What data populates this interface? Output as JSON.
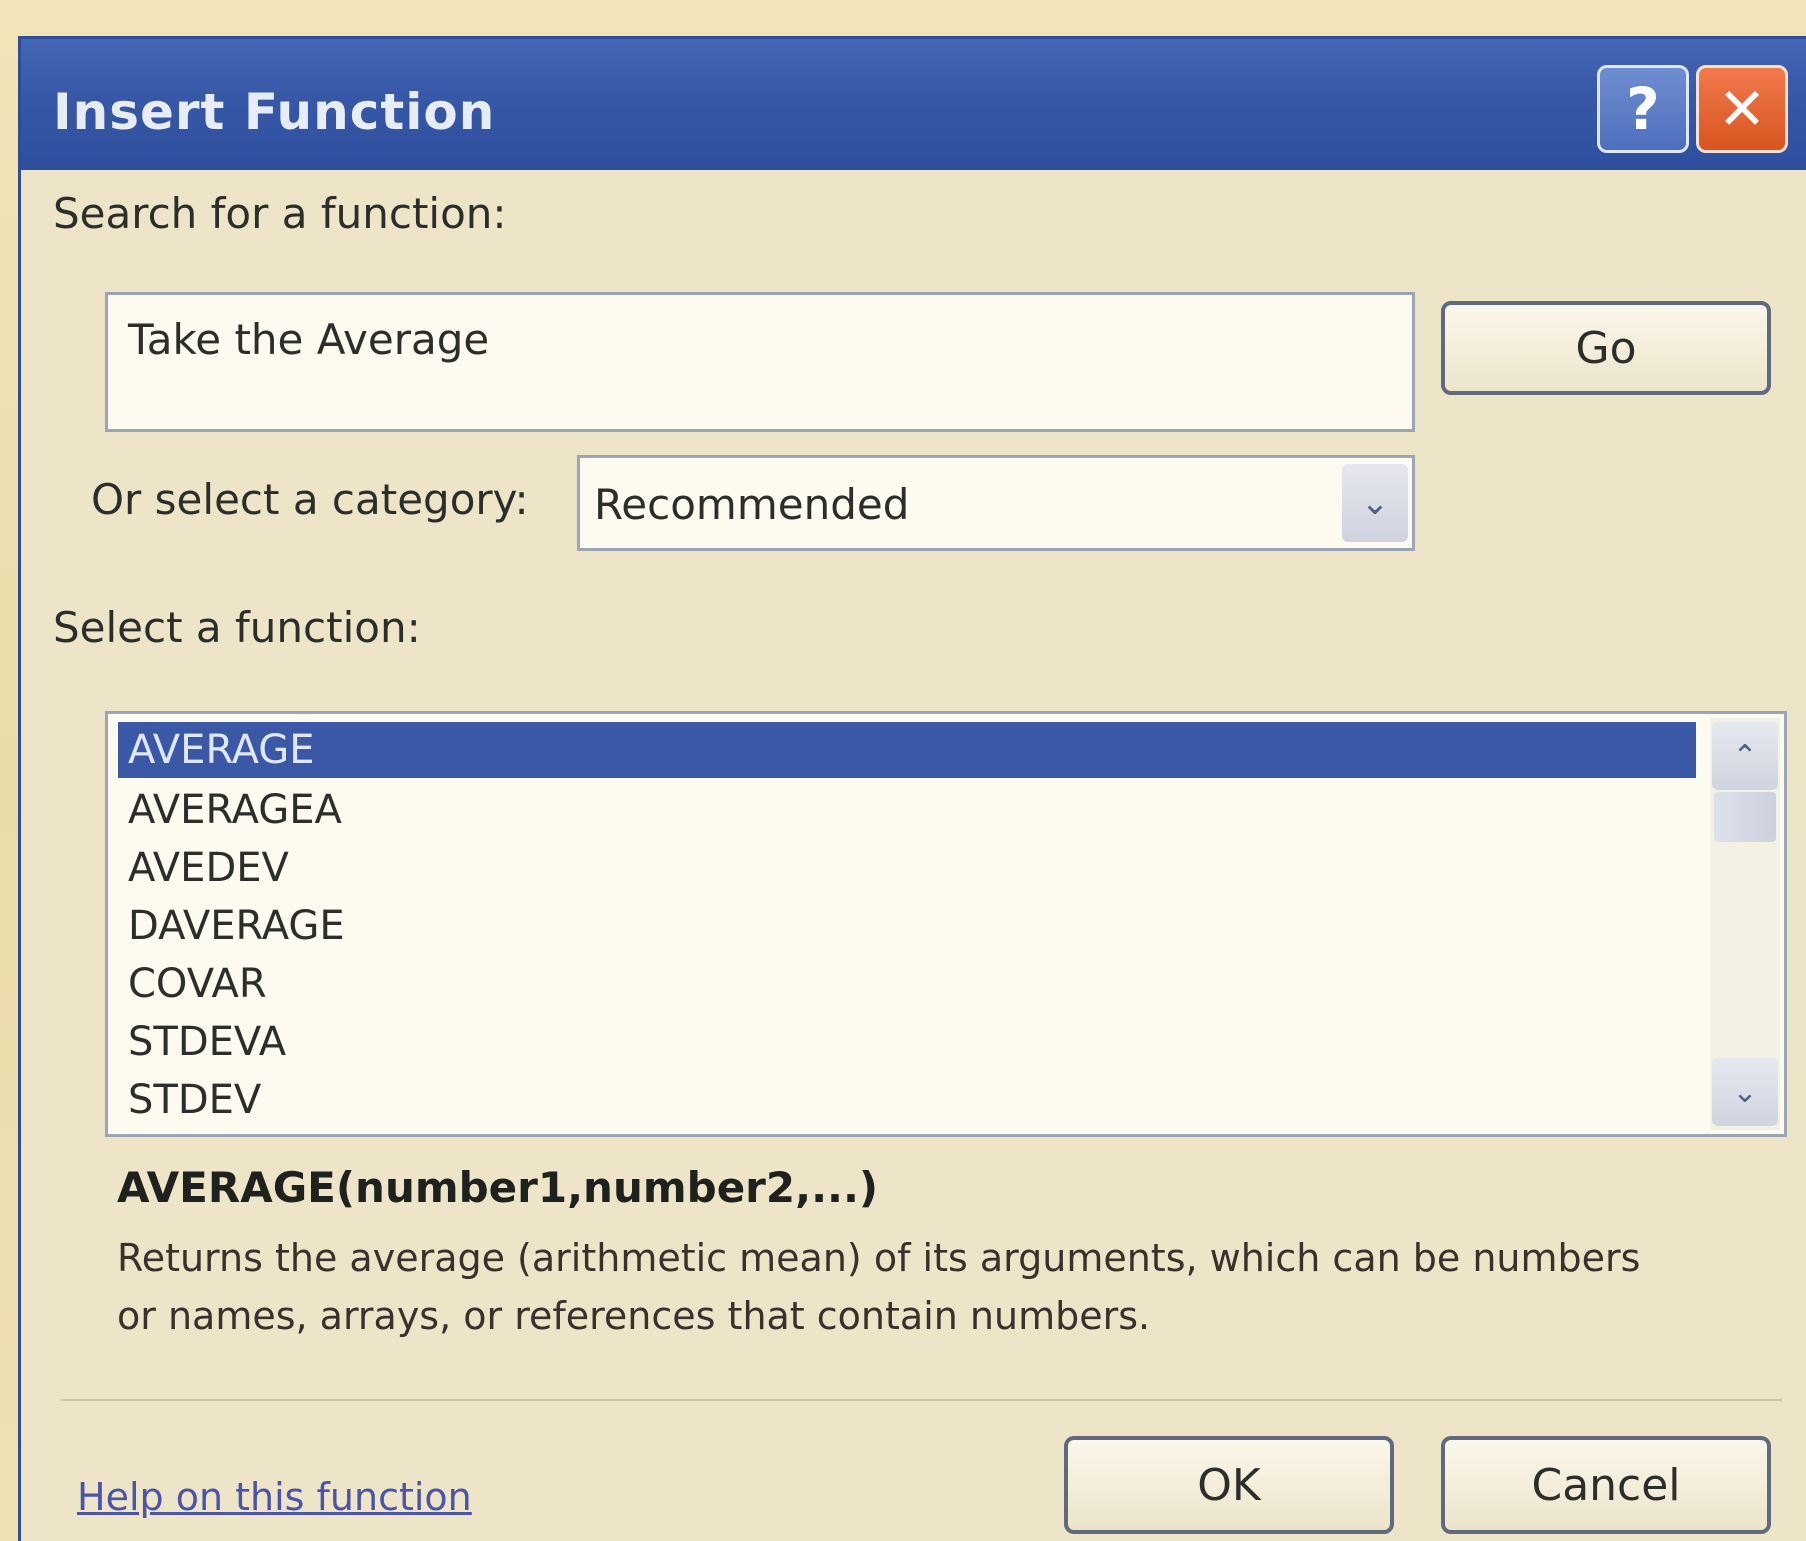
{
  "dialog": {
    "title": "Insert Function",
    "help_button": "?",
    "close_button": "✕"
  },
  "search": {
    "label": "Search for a function:",
    "value": "Take the Average",
    "go_button": "Go"
  },
  "category": {
    "label": "Or select a category:",
    "selected": "Recommended"
  },
  "function_list": {
    "label": "Select a function:",
    "items": [
      "AVERAGE",
      "AVERAGEA",
      "AVEDEV",
      "DAVERAGE",
      "COVAR",
      "STDEVA",
      "STDEV"
    ],
    "selected": "AVERAGE"
  },
  "details": {
    "signature": "AVERAGE(number1,number2,...)",
    "description": "Returns the average (arithmetic mean) of its arguments, which can be numbers or names, arrays, or references that contain numbers."
  },
  "footer": {
    "help_link": "Help on this function",
    "ok_button": "OK",
    "cancel_button": "Cancel"
  }
}
